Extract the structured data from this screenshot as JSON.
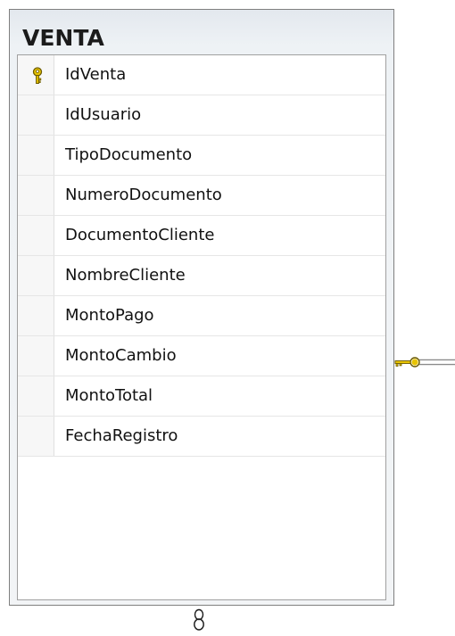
{
  "table": {
    "name": "VENTA",
    "columns": [
      {
        "name": "IdVenta",
        "primary_key": true
      },
      {
        "name": "IdUsuario",
        "primary_key": false
      },
      {
        "name": "TipoDocumento",
        "primary_key": false
      },
      {
        "name": "NumeroDocumento",
        "primary_key": false
      },
      {
        "name": "DocumentoCliente",
        "primary_key": false
      },
      {
        "name": "NombreCliente",
        "primary_key": false
      },
      {
        "name": "MontoPago",
        "primary_key": false
      },
      {
        "name": "MontoCambio",
        "primary_key": false
      },
      {
        "name": "MontoTotal",
        "primary_key": false
      },
      {
        "name": "FechaRegistro",
        "primary_key": false
      }
    ]
  },
  "relationships": [
    {
      "end": "one",
      "symbol": "key-icon",
      "side": "right"
    },
    {
      "end": "many",
      "symbol": "infinity-icon",
      "side": "bottom"
    }
  ],
  "colors": {
    "key": "#e8c400",
    "key_outline": "#6b5a00",
    "connector_line": "#8a8a8a",
    "border": "#7f7f7f"
  }
}
